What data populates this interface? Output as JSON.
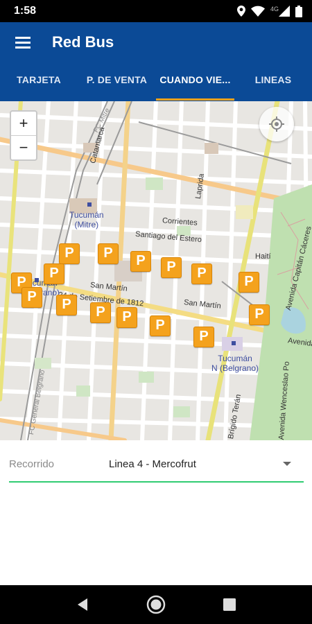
{
  "status_bar": {
    "time": "1:58",
    "network": "4G",
    "icons": [
      "location-icon",
      "wifi-icon",
      "signal-icon",
      "battery-icon"
    ]
  },
  "app_bar": {
    "title": "Red Bus",
    "menu_icon": "menu-icon",
    "color": "#0b4a96"
  },
  "tabs": {
    "items": [
      {
        "label": "TARJETA",
        "active": false
      },
      {
        "label": "P. DE VENTA",
        "active": false
      },
      {
        "label": "CUANDO VIE...",
        "active": true
      },
      {
        "label": "LINEAS",
        "active": false
      }
    ],
    "indicator_color": "#f3a11b"
  },
  "map": {
    "zoom_in": "+",
    "zoom_out": "−",
    "locate_icon": "my-location-icon",
    "marker_label": "P",
    "marker_color": "#f4a21d",
    "labels": {
      "catamarca": "Catamarca",
      "tucuman_mitre_1": "Tucumán",
      "tucuman_mitre_2": "(Mitre)",
      "corrientes": "Corrientes",
      "santiago": "Santiago del Estero",
      "san_martin_1": "San Martín",
      "san_martin_2": "San Martín",
      "sep24": "24 de Setiembre de 1812",
      "tucuman_belgrano_1": "Tucumán",
      "tucuman_belgrano_2": "(Belgrano)",
      "tucuman_n_1": "Tucumán",
      "tucuman_n_2": "N (Belgrano)",
      "laprida": "Laprida",
      "haiti": "Haití",
      "avenida_capitan": "Avenida Capitán Cáceres",
      "avenida_wenceslao": "Avenida Wenceslao Po",
      "avenida": "Avenida",
      "brigido": "Brígido Terán",
      "fc_mitre": "FC Mitre",
      "belgrano_rail": "FC General Belgrano"
    }
  },
  "route_selector": {
    "label": "Recorrido",
    "value": "Linea 4 - Mercofrut",
    "underline_color": "#2fcc71"
  },
  "nav_bar": {
    "buttons": [
      "back-icon",
      "home-icon",
      "recents-icon"
    ]
  }
}
